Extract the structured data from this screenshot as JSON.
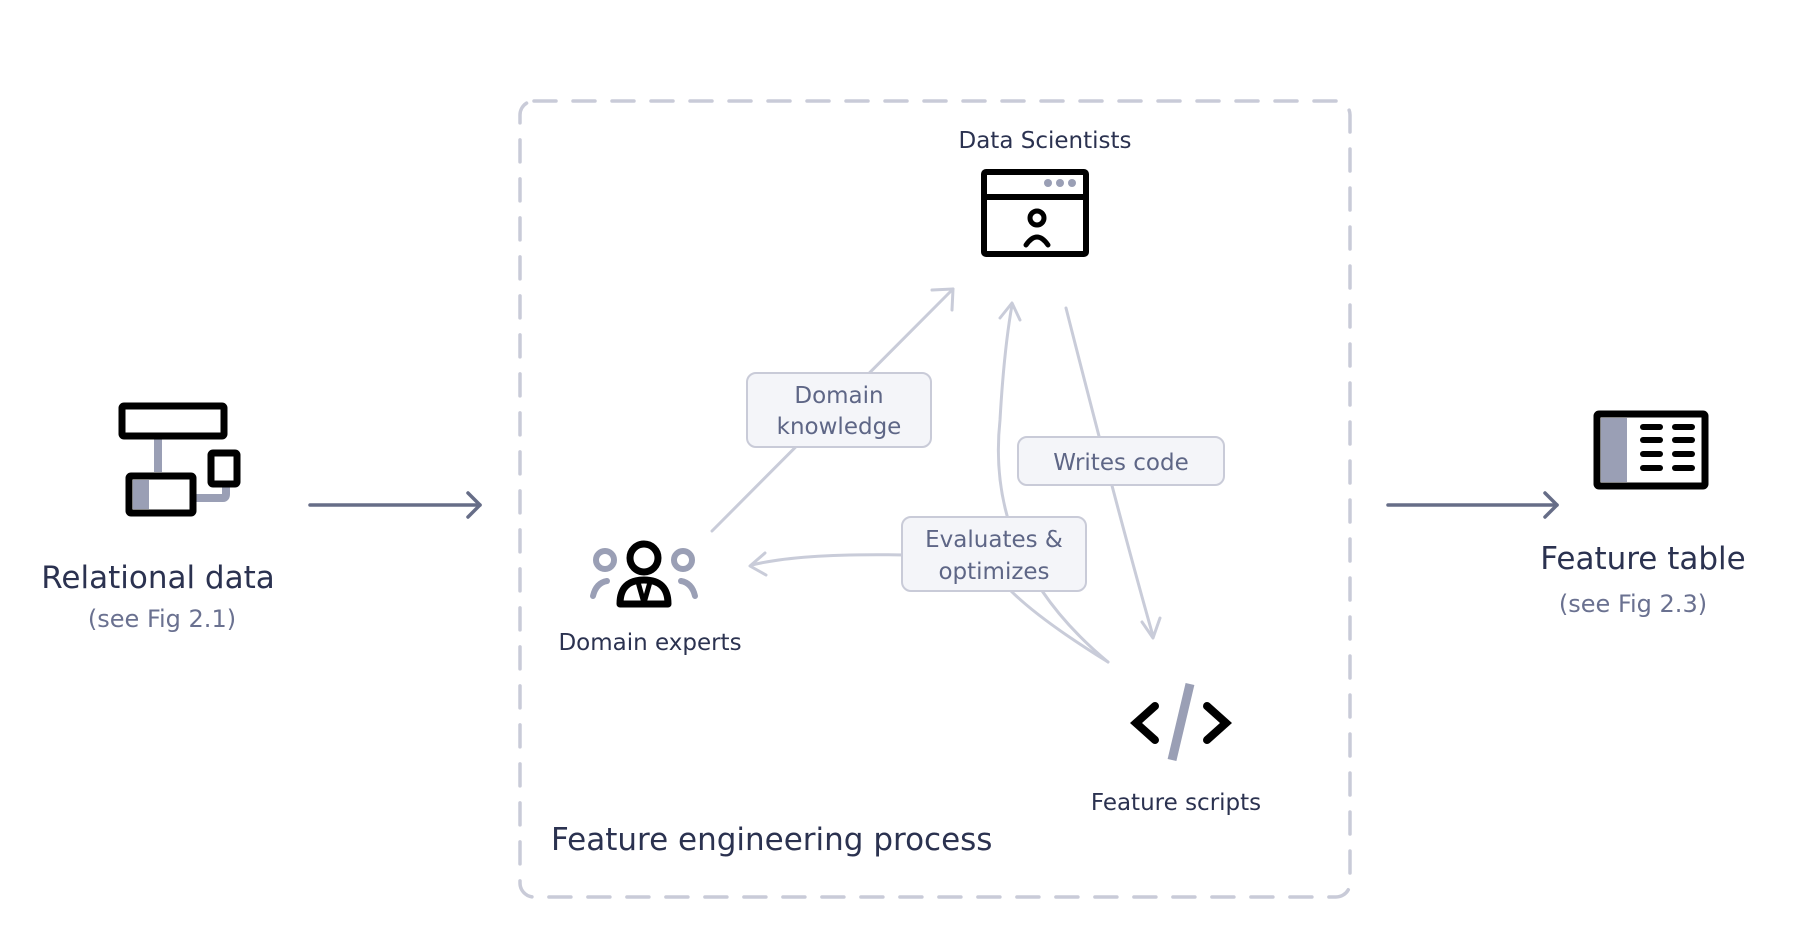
{
  "colors": {
    "text_primary": "#2b3250",
    "text_secondary": "#6a7190",
    "accent_gray": "#9a9fb5",
    "flow_arrow": "#c9ccd9",
    "main_arrow": "#666d87",
    "label_fill": "#f4f5f9",
    "dashed_border": "#c9cbd8"
  },
  "left": {
    "icon": "relational-data-icon",
    "title": "Relational data",
    "subtitle": "(see Fig 2.1)"
  },
  "right": {
    "icon": "feature-table-icon",
    "title": "Feature table",
    "subtitle": "(see Fig 2.3)"
  },
  "process": {
    "title": "Feature engineering process",
    "nodes": {
      "data_scientists": {
        "label": "Data Scientists",
        "icon": "browser-user-icon"
      },
      "domain_experts": {
        "label": "Domain experts",
        "icon": "team-people-icon"
      },
      "feature_scripts": {
        "label": "Feature scripts",
        "icon": "code-icon"
      }
    },
    "edges": {
      "domain_knowledge": {
        "line1": "Domain",
        "line2": "knowledge"
      },
      "writes_code": {
        "label": "Writes code"
      },
      "evaluates": {
        "line1": "Evaluates &",
        "line2": "optimizes"
      }
    }
  }
}
